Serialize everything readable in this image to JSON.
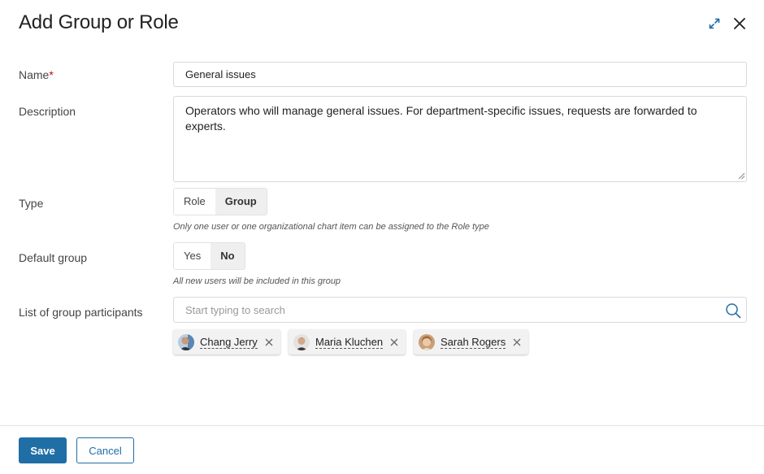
{
  "dialog": {
    "title": "Add Group or Role"
  },
  "fields": {
    "name": {
      "label": "Name",
      "required_marker": "*",
      "value": "General issues"
    },
    "description": {
      "label": "Description",
      "value": "Operators who will manage general issues. For department-specific issues, requests are forwarded to experts."
    },
    "type": {
      "label": "Type",
      "options": [
        "Role",
        "Group"
      ],
      "selected": "Group",
      "hint": "Only one user or one organizational chart item can be assigned to the Role type"
    },
    "default_group": {
      "label": "Default group",
      "options": [
        "Yes",
        "No"
      ],
      "selected": "No",
      "hint": "All new users will be included in this group"
    },
    "participants": {
      "label": "List of group participants",
      "search_placeholder": "Start typing to search",
      "items": [
        {
          "name": "Chang Jerry",
          "avatar": "user-photo"
        },
        {
          "name": "Maria Kluchen",
          "avatar": "user-photo"
        },
        {
          "name": "Sarah Rogers",
          "avatar": "user-photo"
        }
      ]
    }
  },
  "footer": {
    "save_label": "Save",
    "cancel_label": "Cancel"
  },
  "icons": {
    "expand": "expand-icon",
    "close": "close-icon",
    "search": "search-icon",
    "remove": "close-icon"
  },
  "colors": {
    "primary": "#1f6fa6",
    "required": "#d0021b",
    "toggle_active_bg": "#efefef",
    "chip_bg": "#f2f2f2"
  }
}
